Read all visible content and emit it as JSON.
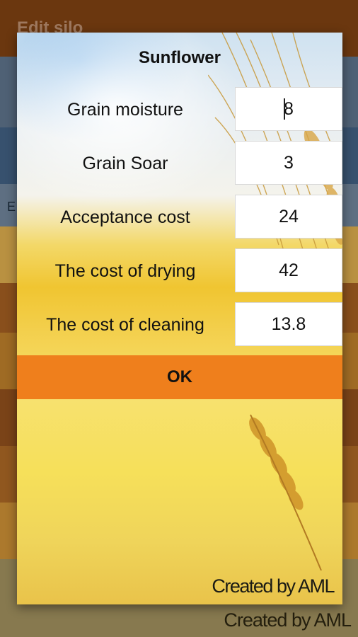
{
  "background": {
    "header_title": "Edit silo",
    "side_letter": "E",
    "footer_credit": "Created by  AML"
  },
  "dialog": {
    "title": "Sunflower",
    "rows": [
      {
        "label": "Grain moisture",
        "value": "8"
      },
      {
        "label": "Grain Soar",
        "value": "3"
      },
      {
        "label": "Acceptance cost",
        "value": "24"
      },
      {
        "label": "The cost of drying",
        "value": "42"
      },
      {
        "label": "The cost of cleaning",
        "value": "13.8"
      }
    ],
    "ok_label": "OK",
    "credit": "Created by  AML"
  },
  "colors": {
    "accent_orange": "#ef7f1c",
    "header_brown": "#7a3f12"
  }
}
